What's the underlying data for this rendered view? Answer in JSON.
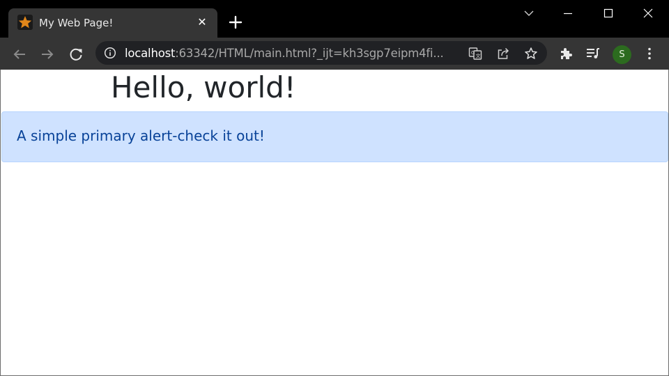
{
  "browser": {
    "tab": {
      "title": "My Web Page!",
      "close_glyph": "✕",
      "favicon": "star-icon",
      "favicon_color": "#e0861a"
    },
    "new_tab_icon": "plus-icon",
    "window_controls": [
      "tab-search-icon",
      "minimize-icon",
      "maximize-icon",
      "close-icon"
    ],
    "toolbar": {
      "back_icon": "arrow-left-icon",
      "forward_icon": "arrow-right-icon",
      "reload_icon": "reload-icon",
      "url_host": "localhost",
      "url_rest": ":63342/HTML/main.html?_ijt=kh3sgp7eipm4fi...",
      "omnibox_icons": [
        "site-info-icon",
        "translate-icon",
        "share-icon",
        "bookmark-star-icon"
      ],
      "extensions_icon": "puzzle-icon",
      "media_icon": "media-queue-icon",
      "profile_initial": "S",
      "profile_color": "#2c6b1f",
      "menu_icon": "kebab-menu-icon"
    }
  },
  "page": {
    "heading": "Hello, world!",
    "alert": {
      "text": "A simple primary alert-check it out!",
      "background": "#cfe2ff",
      "text_color": "#084298"
    }
  }
}
